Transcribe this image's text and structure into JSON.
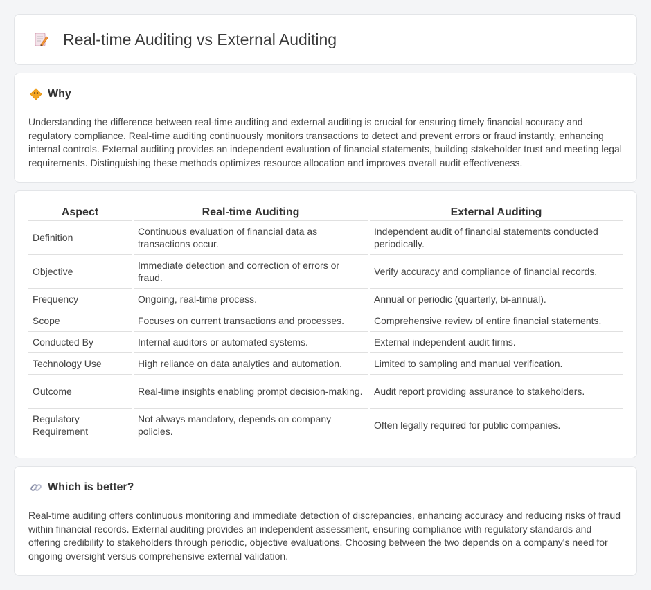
{
  "header": {
    "title": "Real-time Auditing vs External Auditing",
    "icon": "memo-pencil-icon"
  },
  "why": {
    "title": "Why",
    "icon": "diamond-people-icon",
    "text": "Understanding the difference between real-time auditing and external auditing is crucial for ensuring timely financial accuracy and regulatory compliance. Real-time auditing continuously monitors transactions to detect and prevent errors or fraud instantly, enhancing internal controls. External auditing provides an independent evaluation of financial statements, building stakeholder trust and meeting legal requirements. Distinguishing these methods optimizes resource allocation and improves overall audit effectiveness."
  },
  "table": {
    "headers": [
      "Aspect",
      "Real-time Auditing",
      "External Auditing"
    ],
    "rows": [
      [
        "Definition",
        "Continuous evaluation of financial data as transactions occur.",
        "Independent audit of financial statements conducted periodically."
      ],
      [
        "Objective",
        "Immediate detection and correction of errors or fraud.",
        "Verify accuracy and compliance of financial records."
      ],
      [
        "Frequency",
        "Ongoing, real-time process.",
        "Annual or periodic (quarterly, bi-annual)."
      ],
      [
        "Scope",
        "Focuses on current transactions and processes.",
        "Comprehensive review of entire financial statements."
      ],
      [
        "Conducted By",
        "Internal auditors or automated systems.",
        "External independent audit firms."
      ],
      [
        "Technology Use",
        "High reliance on data analytics and automation.",
        "Limited to sampling and manual verification."
      ],
      [
        "Outcome",
        "Real-time insights enabling prompt decision-making.",
        "Audit report providing assurance to stakeholders."
      ],
      [
        "Regulatory Requirement",
        "Not always mandatory, depends on company policies.",
        "Often legally required for public companies."
      ]
    ]
  },
  "better": {
    "title": "Which is better?",
    "icon": "link-icon",
    "text": "Real-time auditing offers continuous monitoring and immediate detection of discrepancies, enhancing accuracy and reducing risks of fraud within financial records. External auditing provides an independent assessment, ensuring compliance with regulatory standards and offering credibility to stakeholders through periodic, objective evaluations. Choosing between the two depends on a company's need for ongoing oversight versus comprehensive external validation."
  }
}
